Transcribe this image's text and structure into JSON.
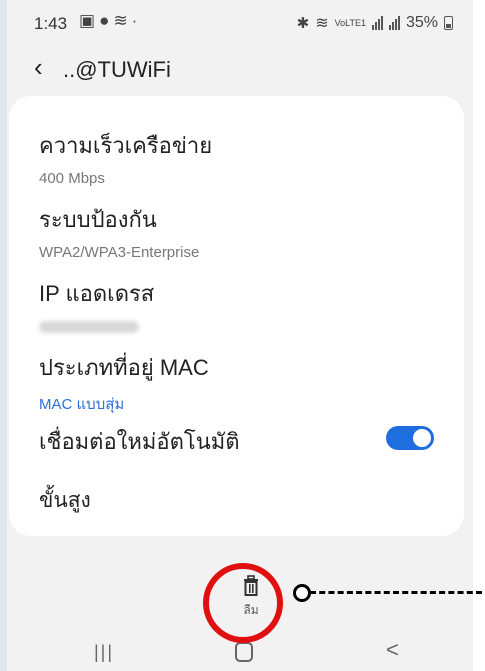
{
  "status_bar": {
    "time": "1:43",
    "left_icons": [
      "gallery-icon",
      "location-icon",
      "wifi-icon",
      "dot-icon"
    ],
    "battery": "35%",
    "volte": "VoLTE1"
  },
  "header": {
    "back_icon": "back-chevron-icon",
    "ssid": "..@TUWiFi"
  },
  "details": {
    "speed_title": "ความเร็วเครือข่าย",
    "speed_value": "400 Mbps",
    "security_title": "ระบบป้องกัน",
    "security_value": "WPA2/WPA3-Enterprise",
    "ip_title": "IP แอดเดรส",
    "mac_title": "ประเภทที่อยู่ MAC",
    "mac_value": "MAC แบบสุ่ม",
    "autoconnect_title": "เชื่อมต่อใหม่อัตโนมัติ",
    "autoconnect_on": true,
    "advanced_title": "ขั้นสูง"
  },
  "forget": {
    "label": "ลืม",
    "icon": "trash-icon"
  },
  "nav": {
    "recent": "|||",
    "back": "<"
  },
  "colors": {
    "accent": "#1f6ee0",
    "link": "#2f6ed6",
    "annotation": "#e01010"
  }
}
